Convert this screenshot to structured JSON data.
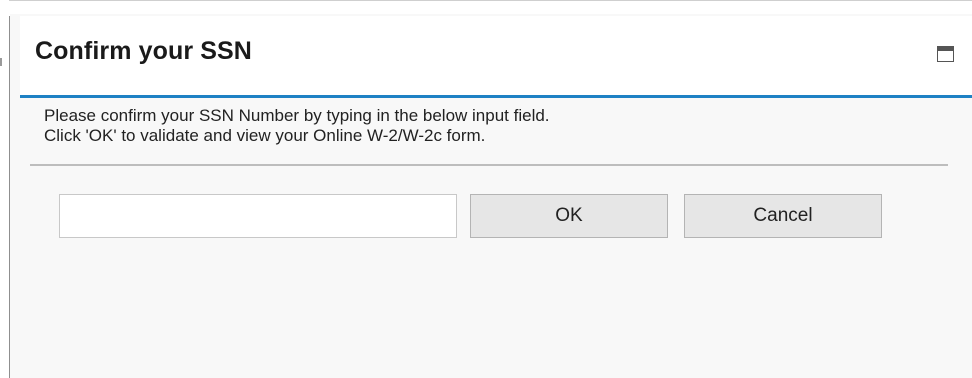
{
  "dialog": {
    "title": "Confirm your SSN",
    "window_icon": "restore-window-icon",
    "accent_color": "#1e81c4",
    "message_line1": "Please confirm your SSN Number by typing in the below input field.",
    "message_line2": "Click 'OK' to validate and view your Online W-2/W-2c form.",
    "ssn_input": {
      "value": "",
      "placeholder": ""
    },
    "ok_label": "OK",
    "cancel_label": "Cancel"
  }
}
